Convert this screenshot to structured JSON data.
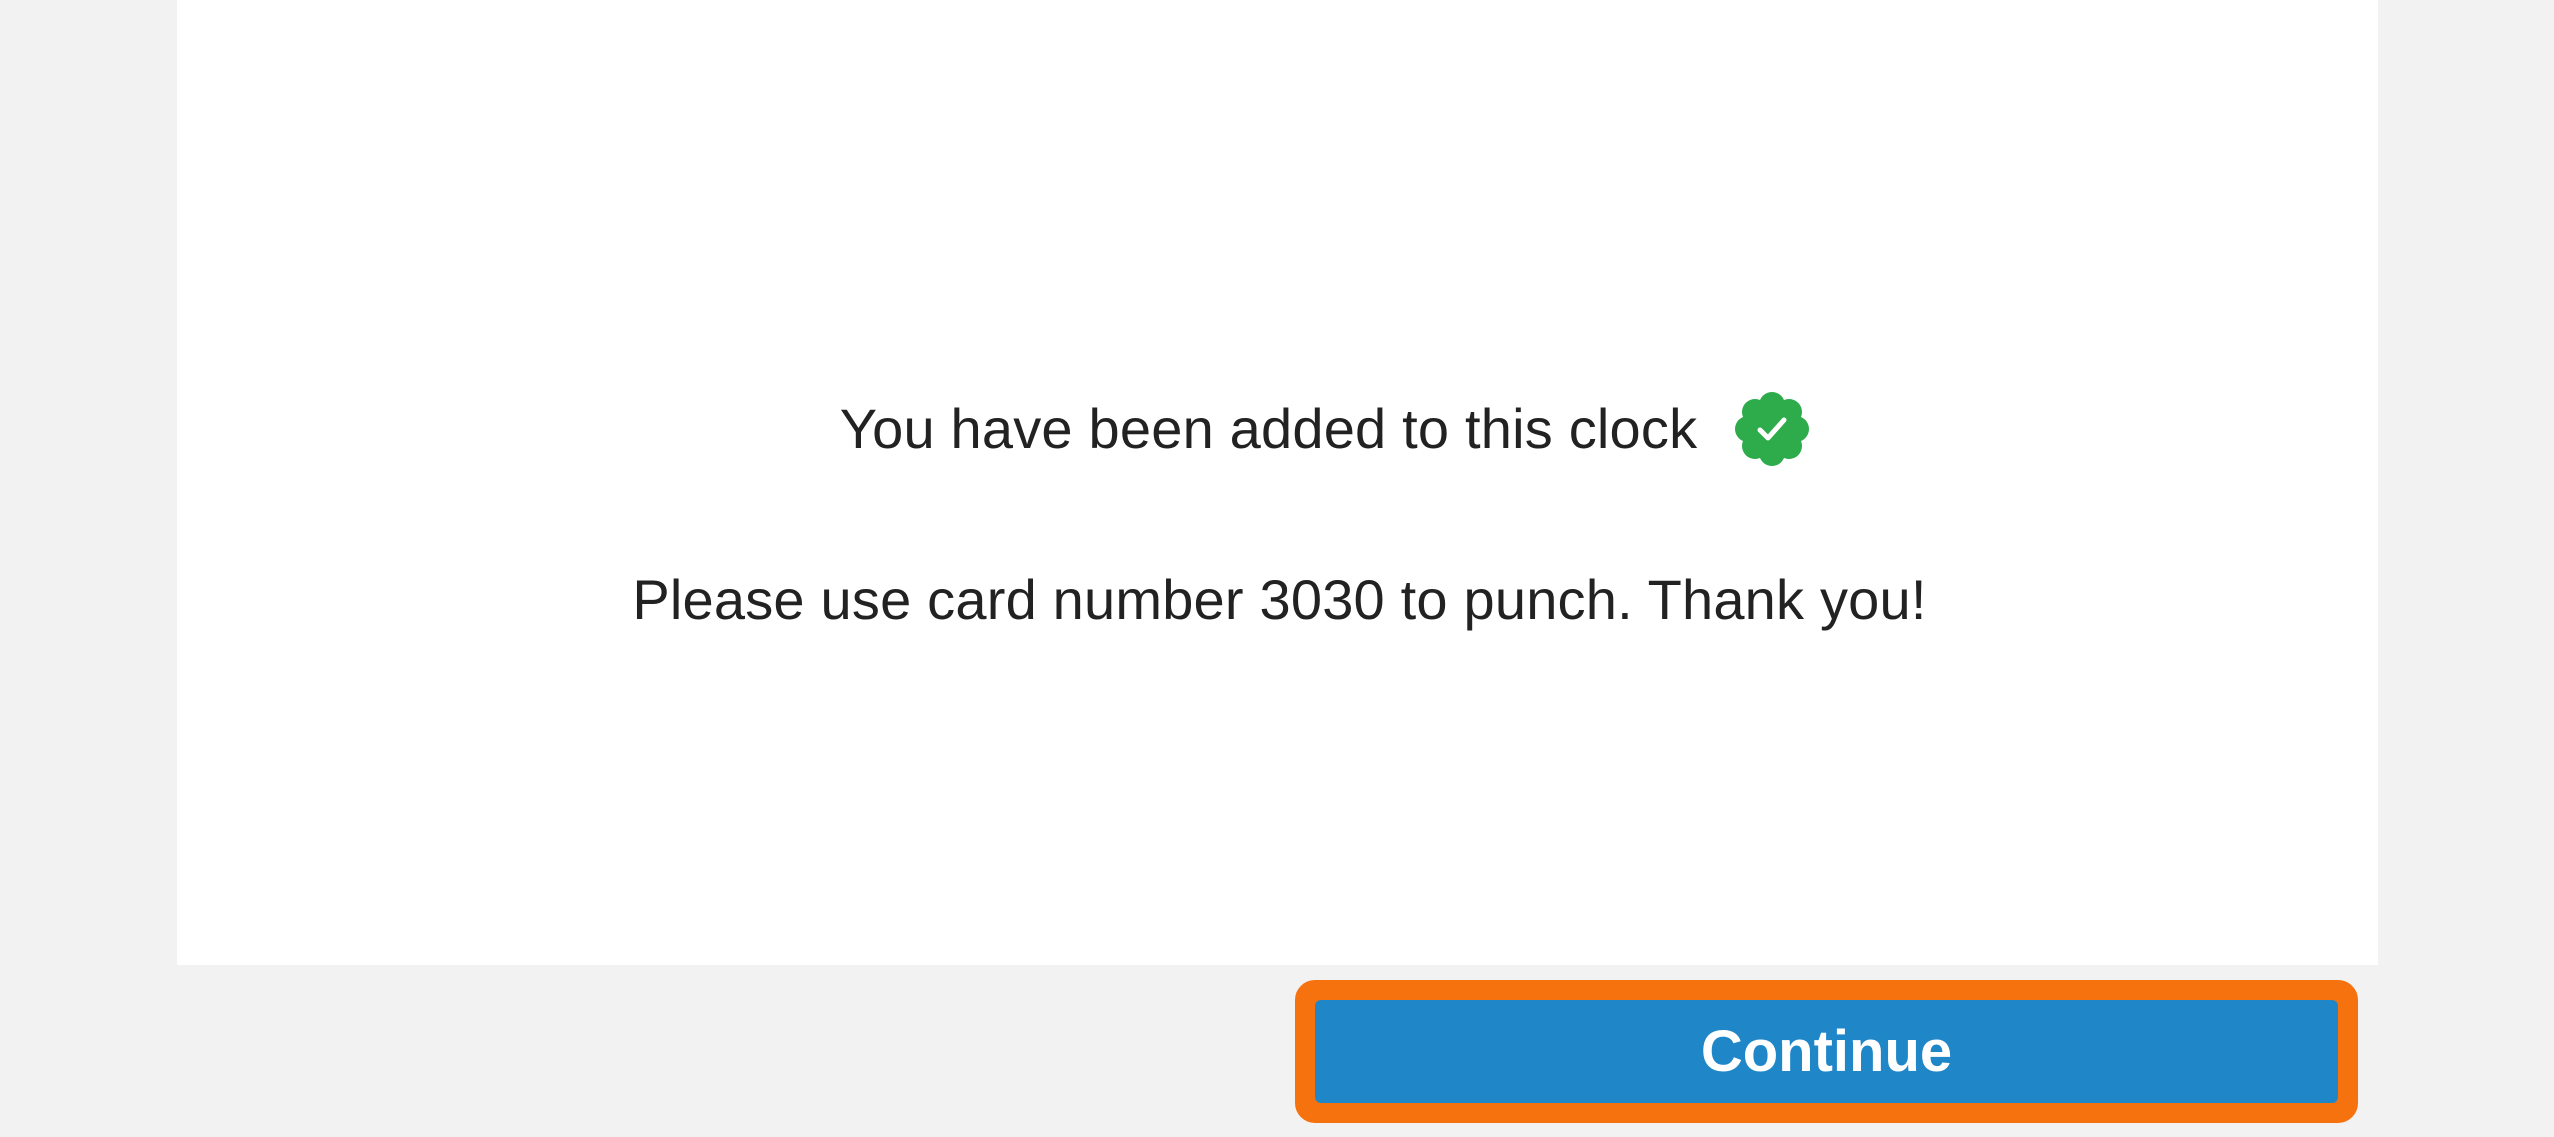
{
  "confirmation": {
    "headline": "You have been added to this clock",
    "message": "Please use card number 3030 to punch. Thank you!",
    "icon": "verified-check-icon"
  },
  "actions": {
    "continue_label": "Continue"
  },
  "colors": {
    "background": "#f2f2f2",
    "card": "#ffffff",
    "text": "#222222",
    "verified_green": "#2eab4b",
    "button_blue": "#1f86c8",
    "highlight_orange": "#f5720e"
  }
}
